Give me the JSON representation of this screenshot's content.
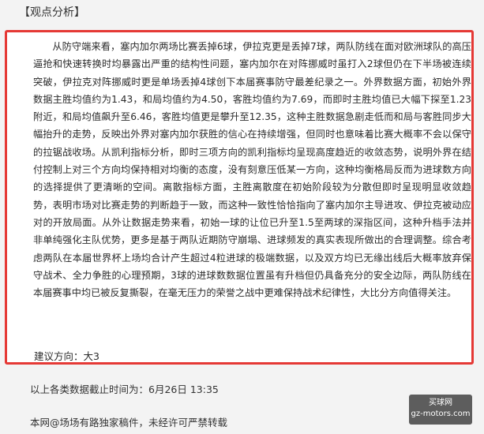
{
  "section_title": "【观点分析】",
  "analysis": {
    "body": "从防守端来看，塞内加尔两场比赛丢掉6球，伊拉克更是丢掉7球，两队防线在面对欧洲球队的高压逼抢和快速转换时均暴露出严重的结构性问题，塞内加尔在对阵挪威时虽打入2球但仍在下半场被连续突破，伊拉克对阵挪威时更是单场丢掉4球创下本届赛事防守最差纪录之一。外界数据方面，初始外界数据主胜均值约为1.43，和局均值约为4.50，客胜均值约为7.69，而即时主胜均值已大幅下探至1.23附近，和局均值飙升至6.46，客胜均值更是攀升至12.35，这种主胜数据急剧走低而和局与客胜同步大幅抬升的走势，反映出外界对塞内加尔获胜的信心在持续增强，但同时也意味着比赛大概率不会以保守的拉锯战收场。从凯利指标分析，即时三项方向的凯利指标均呈现高度趋近的收敛态势，说明外界在结付控制上对三个方向均保持相对均衡的态度，没有刻意压低某一方向，这种均衡格局反而为进球数方向的选择提供了更清晰的空间。离散指标方面，主胜离散度在初始阶段较为分散但即时呈现明显收敛趋势，表明市场对比赛走势的判断趋于一致，而这种一致性恰恰指向了塞内加尔主导进攻、伊拉克被动应对的开放局面。从外让数据走势来看，初始一球的让位已升至1.5至两球的深指区间，这种升档手法并非单纯强化主队优势，更多是基于两队近期防守崩塌、进球频发的真实表现所做出的合理调整。综合考虑两队在本届世界杯上场均合计产生超过4粒进球的极端数据，以及双方均已无缘出线后大概率放弃保守战术、全力争胜的心理预期，3球的进球数数据位置虽有升档但仍具备充分的安全边际，两队防线在本届赛事中均已被反复撕裂，在毫无压力的荣誉之战中更难保持战术纪律性，大比分方向值得关注。",
    "advice": "建议方向：大3"
  },
  "footer": {
    "cutoff": "以上各类数据截止时间为：6月26日 13:35",
    "copyright": "本网@场场有路独家稿件，未经许可严禁转载"
  },
  "watermark": {
    "top": "买球网",
    "bottom": "gz-motors.com"
  },
  "colors": {
    "box_border": "#e53935",
    "background": "#f3f3f3",
    "text": "#2b2b2b"
  }
}
